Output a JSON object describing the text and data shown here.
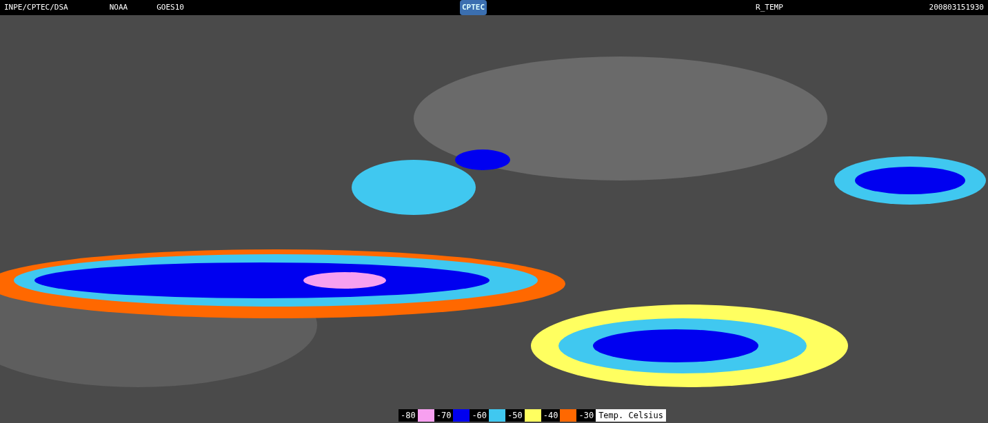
{
  "header": {
    "source": "INPE/CPTEC/DSA",
    "agency": "NOAA",
    "satellite": "GOES10",
    "logo": "CPTEC",
    "product": "R_TEMP",
    "timestamp": "200803151930"
  },
  "legend": {
    "items": [
      {
        "label": "-80",
        "color": "#f7a0f0"
      },
      {
        "label": "-70",
        "color": "#0000f0"
      },
      {
        "label": "-60",
        "color": "#40c8f0"
      },
      {
        "label": "-50",
        "color": "#ffff60"
      },
      {
        "label": "-40",
        "color": "#ff6800"
      },
      {
        "label": "-30"
      }
    ],
    "title": "Temp. Celsius"
  }
}
